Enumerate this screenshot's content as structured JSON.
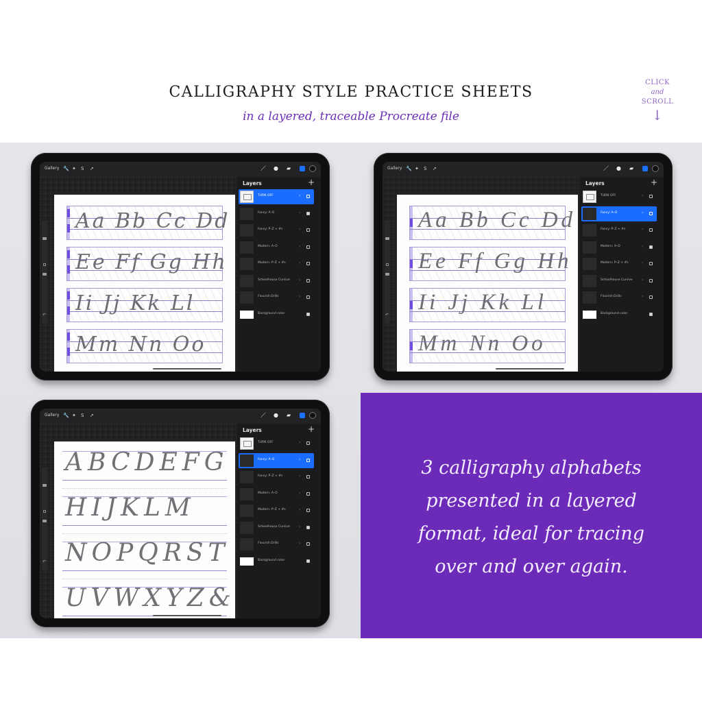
{
  "header": {
    "title": "CALLIGRAPHY STYLE PRACTICE SHEETS",
    "subtitle": "in a layered, traceable Procreate file",
    "scroll_hint": {
      "line1": "CLICK",
      "line2": "and",
      "line3": "SCROLL",
      "arrow": "↓"
    }
  },
  "colors": {
    "brand_purple": "#6b2bb8",
    "accent_purple_text": "#6a2fb8",
    "procreate_blue": "#1a6dff"
  },
  "procreate": {
    "gallery_label": "Gallery",
    "tools_left": [
      "wrench-icon",
      "magic-wand-icon",
      "selection-icon",
      "transform-icon"
    ],
    "tools_right": [
      "brush-icon",
      "smudge-icon",
      "eraser-icon",
      "layers-icon",
      "color-icon"
    ],
    "glyphs": {
      "wrench": "🔧",
      "wand": "✦",
      "select": "S",
      "move": "➚",
      "brush": "／",
      "smudge": "●",
      "eraser": "▰",
      "plus": "+",
      "chevron": "›",
      "undo": "↶"
    },
    "layers_title": "Layers"
  },
  "ipads": [
    {
      "id": "fancy-sheet",
      "active_layer": 0,
      "layers": [
        {
          "name": "TURN OFF",
          "thumb": "light",
          "checked": false
        },
        {
          "name": "Fancy: A–O",
          "thumb": "dark",
          "checked": true
        },
        {
          "name": "Fancy: P–Z + #s",
          "thumb": "dark",
          "checked": false
        },
        {
          "name": "Modern: A–O",
          "thumb": "dark",
          "checked": false
        },
        {
          "name": "Modern: P–Z + #s",
          "thumb": "dark",
          "checked": false
        },
        {
          "name": "Schoolhouse Cursive",
          "thumb": "dark",
          "checked": false
        },
        {
          "name": "Flourish Drills",
          "thumb": "dark",
          "checked": false
        },
        {
          "name": "Background color",
          "thumb": "white",
          "checked": true
        }
      ],
      "rows": [
        "Aa Bb Cc Dd",
        "Ee Ff Gg Hh",
        "Ii Jj Kk Ll",
        "Mm Nn Oo"
      ]
    },
    {
      "id": "modern-sheet",
      "active_layer": 1,
      "layers": [
        {
          "name": "TURN OFF",
          "thumb": "light",
          "checked": false
        },
        {
          "name": "Fancy: A–O",
          "thumb": "dark",
          "checked": false
        },
        {
          "name": "Fancy: P–Z + #s",
          "thumb": "dark",
          "checked": false
        },
        {
          "name": "Modern: A–O",
          "thumb": "dark",
          "checked": true
        },
        {
          "name": "Modern: P–Z + #s",
          "thumb": "dark",
          "checked": false
        },
        {
          "name": "Schoolhouse Cursive",
          "thumb": "dark",
          "checked": false
        },
        {
          "name": "Flourish Drills",
          "thumb": "dark",
          "checked": false
        },
        {
          "name": "Background color",
          "thumb": "white",
          "checked": true
        }
      ],
      "rows": [
        "Aa Bb Cc Dd",
        "Ee Ff Gg Hh",
        "Ii Jj Kk Ll",
        "Mm Nn Oo"
      ]
    },
    {
      "id": "schoolhouse-sheet",
      "active_layer": 1,
      "layers": [
        {
          "name": "TURN OFF",
          "thumb": "light",
          "checked": false
        },
        {
          "name": "Fancy: A–O",
          "thumb": "dark",
          "checked": false
        },
        {
          "name": "Fancy: P–Z + #s",
          "thumb": "dark",
          "checked": false
        },
        {
          "name": "Modern: A–O",
          "thumb": "dark",
          "checked": false
        },
        {
          "name": "Modern: P–Z + #s",
          "thumb": "dark",
          "checked": false
        },
        {
          "name": "Schoolhouse Cursive",
          "thumb": "dark",
          "checked": true
        },
        {
          "name": "Flourish Drills",
          "thumb": "dark",
          "checked": false
        },
        {
          "name": "Background color",
          "thumb": "white",
          "checked": true
        }
      ],
      "rows": [
        "ABCDEFG",
        "HIJKLM",
        "NOPQRST",
        "UVWXYZ&"
      ]
    }
  ],
  "promo": {
    "lines": [
      "3 calligraphy alphabets",
      "presented in a layered",
      "format, ideal for tracing",
      "over and over again."
    ]
  }
}
